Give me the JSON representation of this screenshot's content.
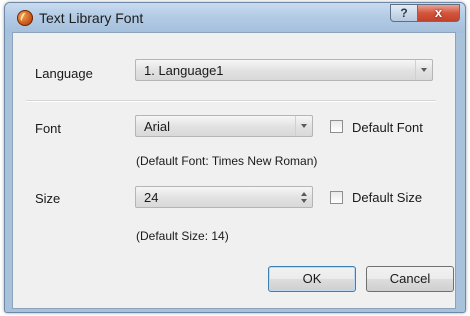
{
  "window": {
    "title": "Text Library Font"
  },
  "titlebar": {
    "help_label": "?",
    "close_label": "x"
  },
  "language": {
    "label": "Language",
    "value": "1.  Language1"
  },
  "font": {
    "label": "Font",
    "value": "Arial",
    "default_checkbox_label": "Default Font",
    "default_checked": false,
    "note": "(Default Font: Times New Roman)"
  },
  "size": {
    "label": "Size",
    "value": "24",
    "default_checkbox_label": "Default Size",
    "default_checked": false,
    "note": "(Default Size: 14)"
  },
  "buttons": {
    "ok": "OK",
    "cancel": "Cancel"
  }
}
